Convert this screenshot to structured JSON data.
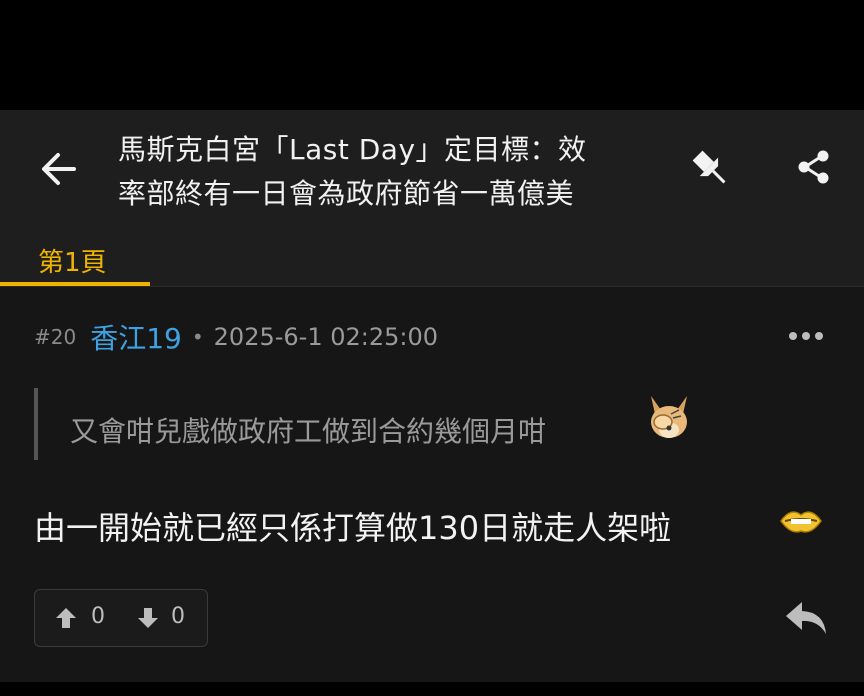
{
  "header": {
    "title_line1": "馬斯克白宮「Last Day」定目標：效",
    "title_line2": "率部終有一日會為政府節省一萬億美"
  },
  "tabs": [
    {
      "label": "第1頁",
      "active": true
    }
  ],
  "post": {
    "floor": "#20",
    "username": "香江19",
    "separator": "•",
    "timestamp": "2025-6-1 02:25:00",
    "quote_text": "又會咁兒戲做政府工做到合約幾個月咁",
    "body_text": "由一開始就已經只係打算做130日就走人架啦",
    "upvotes": "0",
    "downvotes": "0"
  },
  "icons": {
    "back": "arrow-left-icon",
    "pin": "pin-icon",
    "share": "share-icon",
    "more": "more-horizontal-icon",
    "upvote": "arrow-up-icon",
    "downvote": "arrow-down-icon",
    "reply": "reply-icon"
  },
  "colors": {
    "accent": "#f0b400",
    "username": "#3ea2e2",
    "background": "#161616",
    "header": "#1e1e1e"
  }
}
